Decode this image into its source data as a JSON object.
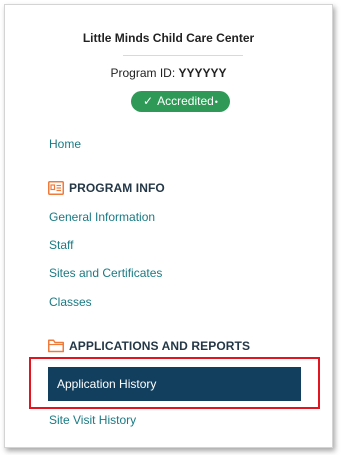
{
  "program": {
    "center_name": "Little Minds Child Care Center",
    "id_label": "Program ID:",
    "id_value": "YYYYYY",
    "badge": {
      "check_icon": "✓",
      "label": "Accredited",
      "dot": "•",
      "color": "#2f9a57"
    }
  },
  "nav": {
    "home_label": "Home",
    "program_info": {
      "icon": "id-card-icon",
      "title": "PROGRAM INFO",
      "items": [
        {
          "label": "General Information"
        },
        {
          "label": "Staff"
        },
        {
          "label": "Sites and Certificates"
        },
        {
          "label": "Classes"
        }
      ]
    },
    "applications": {
      "icon": "folder-icon",
      "title": "APPLICATIONS AND REPORTS",
      "items": [
        {
          "label": "Application History",
          "active": true
        },
        {
          "label": "Site Visit History"
        }
      ]
    }
  },
  "colors": {
    "link": "#1a7a84",
    "section_icon": "#f07a3a",
    "active_bg": "#123f5e",
    "highlight_border": "#e2141f"
  }
}
